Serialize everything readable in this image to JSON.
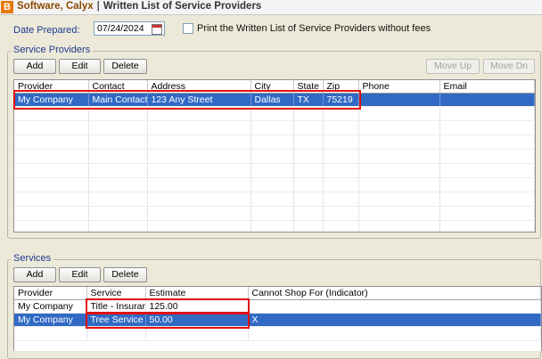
{
  "window": {
    "app_icon_letter": "B",
    "app_name": "Software, Calyx",
    "separator": "|",
    "screen_title": "Written List of Service Providers"
  },
  "form": {
    "date_label": "Date Prepared:",
    "date_value": "07/24/2024",
    "print_checkbox_label": "Print the Written List of Service Providers without fees",
    "print_checkbox_checked": false
  },
  "providers": {
    "group_label": "Service Providers",
    "buttons": {
      "add": "Add",
      "edit": "Edit",
      "delete": "Delete",
      "move_up": "Move Up",
      "move_down": "Move Dn"
    },
    "columns": [
      "Provider",
      "Contact",
      "Address",
      "City",
      "State",
      "Zip",
      "Phone",
      "Email"
    ],
    "rows": [
      {
        "provider": "My Company",
        "contact": "Main Contact",
        "address": "123 Any Street",
        "city": "Dallas",
        "state": "TX",
        "zip": "75219",
        "phone": "",
        "email": "",
        "selected": true
      }
    ]
  },
  "services": {
    "group_label": "Services",
    "buttons": {
      "add": "Add",
      "edit": "Edit",
      "delete": "Delete"
    },
    "columns": [
      "Provider",
      "Service",
      "Estimate",
      "Cannot Shop For (Indicator)"
    ],
    "rows": [
      {
        "provider": "My Company",
        "service": "Title - Insurance",
        "estimate": "125.00",
        "cannot_shop": "",
        "selected": false
      },
      {
        "provider": "My Company",
        "service": "Tree Service",
        "estimate": "50.00",
        "cannot_shop": "X",
        "selected": true
      }
    ]
  },
  "colors": {
    "selection": "#316ac5",
    "highlight_box": "#e01010",
    "label_blue": "#1f3a8f",
    "app_icon": "#e87800"
  }
}
